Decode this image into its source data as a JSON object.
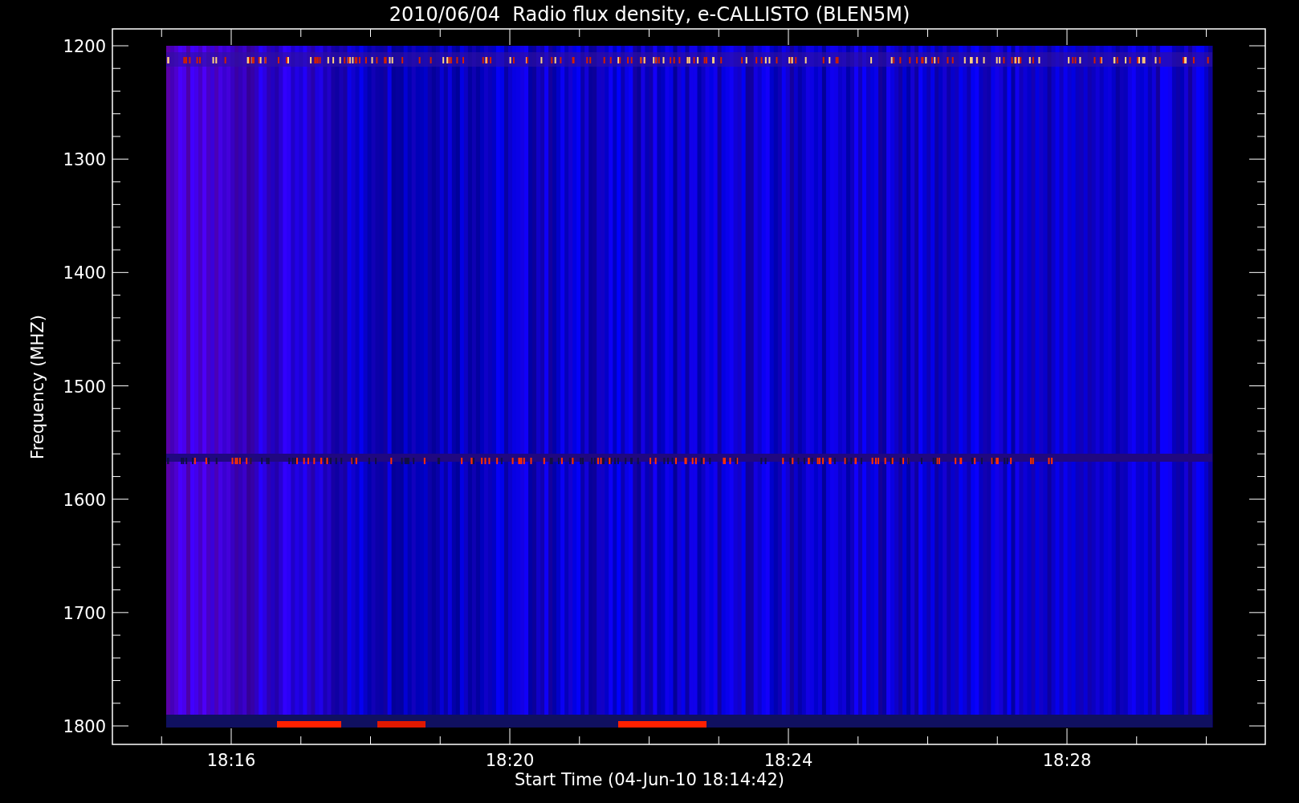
{
  "title": "2010/06/04  Radio flux density, e-CALLISTO (BLEN5M)",
  "y_axis": {
    "label": "Frequency (MHZ)",
    "ticks": [
      "1200",
      "1300",
      "1400",
      "1500",
      "1600",
      "1700",
      "1800"
    ]
  },
  "x_axis": {
    "label": "Start Time (04-Jun-10 18:14:42)",
    "ticks": [
      "18:16",
      "18:20",
      "18:24",
      "18:28"
    ]
  }
}
